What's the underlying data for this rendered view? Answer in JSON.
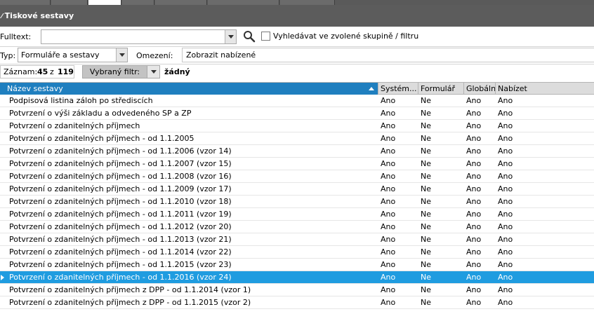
{
  "window": {
    "title": "Tiskové sestavy"
  },
  "toolbar": {
    "fulltext_label": "Fulltext:",
    "fulltext_value": "",
    "group_search_label": "Vyhledávat ve zvolené skupině / filtru",
    "group_search_checked": false,
    "typ_label": "Typ:",
    "typ_value": "Formuláře a sestavy",
    "omezeni_label": "Omezení:",
    "omezeni_value": "Zobrazit nabízené",
    "zaznam_label": "Záznam:",
    "zaznam_current": "45",
    "zaznam_of": "z",
    "zaznam_total": "119",
    "filter_button_label": "Vybraný filtr:",
    "filter_value": "žádný"
  },
  "grid": {
    "columns": [
      "Název sestavy",
      "Systém...",
      "Formulář",
      "Globální",
      "Nabízet"
    ],
    "selected_row_index": 14,
    "rows": [
      [
        "Podpisová listina záloh po střediscích",
        "Ano",
        "Ne",
        "Ano",
        "Ano"
      ],
      [
        "Potvrzení o výši základu a odvedeného SP a ZP",
        "Ano",
        "Ne",
        "Ano",
        "Ano"
      ],
      [
        "Potvrzení o zdanitelných příjmech",
        "Ano",
        "Ne",
        "Ano",
        "Ano"
      ],
      [
        "Potvrzení o zdanitelných příjmech - od 1.1.2005",
        "Ano",
        "Ne",
        "Ano",
        "Ano"
      ],
      [
        "Potvrzení o zdanitelných příjmech - od 1.1.2006 (vzor 14)",
        "Ano",
        "Ne",
        "Ano",
        "Ano"
      ],
      [
        "Potvrzení o zdanitelných příjmech - od 1.1.2007 (vzor 15)",
        "Ano",
        "Ne",
        "Ano",
        "Ano"
      ],
      [
        "Potvrzení o zdanitelných příjmech - od 1.1.2008 (vzor 16)",
        "Ano",
        "Ne",
        "Ano",
        "Ano"
      ],
      [
        "Potvrzení o zdanitelných příjmech - od 1.1.2009 (vzor 17)",
        "Ano",
        "Ne",
        "Ano",
        "Ano"
      ],
      [
        "Potvrzení o zdanitelných příjmech - od 1.1.2010 (vzor 18)",
        "Ano",
        "Ne",
        "Ano",
        "Ano"
      ],
      [
        "Potvrzení o zdanitelných příjmech - od 1.1.2011 (vzor 19)",
        "Ano",
        "Ne",
        "Ano",
        "Ano"
      ],
      [
        "Potvrzení o zdanitelných příjmech - od 1.1.2012 (vzor 20)",
        "Ano",
        "Ne",
        "Ano",
        "Ano"
      ],
      [
        "Potvrzení o zdanitelných příjmech - od 1.1.2013 (vzor 21)",
        "Ano",
        "Ne",
        "Ano",
        "Ano"
      ],
      [
        "Potvrzení o zdanitelných příjmech - od 1.1.2014 (vzor 22)",
        "Ano",
        "Ne",
        "Ano",
        "Ano"
      ],
      [
        "Potvrzení o zdanitelných příjmech - od 1.1.2015 (vzor 23)",
        "Ano",
        "Ne",
        "Ano",
        "Ano"
      ],
      [
        "Potvrzení o zdanitelných příjmech - od 1.1.2016 (vzor 24)",
        "Ano",
        "Ne",
        "Ano",
        "Ano"
      ],
      [
        "Potvrzení o zdanitelných příjmech z DPP - od 1.1.2014 (vzor 1)",
        "Ano",
        "Ne",
        "Ano",
        "Ano"
      ],
      [
        "Potvrzení o zdanitelných příjmech z DPP - od 1.1.2015 (vzor 2)",
        "Ano",
        "Ne",
        "Ano",
        "Ano"
      ]
    ]
  },
  "colors": {
    "titlebar": "#5c5c5c",
    "header_sorted": "#1f7fbf",
    "selected_row": "#1f9ce0"
  },
  "icons": [
    "search-icon",
    "chevron-down-icon",
    "sort-ascending-icon",
    "row-pointer-icon"
  ]
}
